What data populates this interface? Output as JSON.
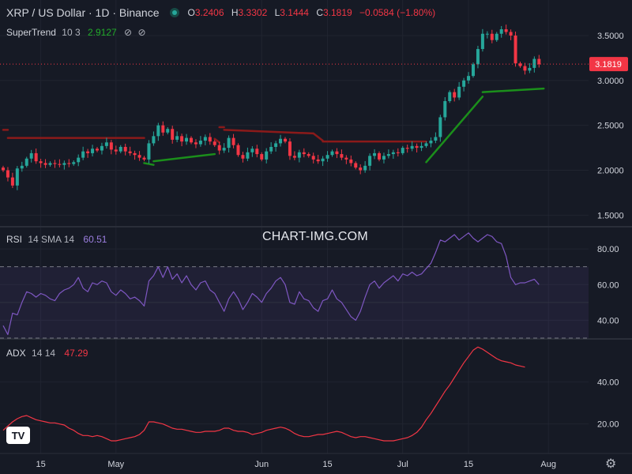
{
  "header": {
    "symbol_title": "XRP / US Dollar · 1D · Binance",
    "ohlc": {
      "o_label": "O",
      "o_value": "3.2406",
      "h_label": "H",
      "h_value": "3.3302",
      "l_label": "L",
      "l_value": "3.1444",
      "c_label": "C",
      "c_value": "3.1819",
      "change": "−0.0584 (−1.80%)"
    }
  },
  "indicators": {
    "supertrend": {
      "name": "SuperTrend",
      "params": "10 3",
      "value": "2.9127"
    },
    "rsi": {
      "name": "RSI",
      "params": "14 SMA 14",
      "value": "60.51"
    },
    "adx": {
      "name": "ADX",
      "params": "14 14",
      "value": "47.29"
    }
  },
  "watermark": "CHART-IMG.COM",
  "logo_text": "TV",
  "icons": [
    "eye-off-icon",
    "settings-gear-icon",
    "live-dot-icon",
    "tradingview-logo"
  ],
  "colors": {
    "background": "#161a25",
    "up": "#26a69a",
    "down": "#f23645",
    "supertrend_up": "#1b8f1b",
    "supertrend_down": "#8b1a1a",
    "rsi_line": "#7e57c2",
    "adx_line": "#f23645"
  },
  "chart_data": [
    {
      "type": "candlestick",
      "title": "XRP / US Dollar · 1D · Binance",
      "y_ticks": [
        "1.5000",
        "2.0000",
        "2.5000",
        "3.0000",
        "3.5000"
      ],
      "ylim": [
        1.38,
        3.72
      ],
      "last_price": "3.1819",
      "x_ticks": [
        {
          "label": "15",
          "index": 8
        },
        {
          "label": "May",
          "index": 24
        },
        {
          "label": "Jun",
          "index": 55
        },
        {
          "label": "15",
          "index": 69
        },
        {
          "label": "Jul",
          "index": 85
        },
        {
          "label": "15",
          "index": 99
        },
        {
          "label": "Aug",
          "index": 116
        }
      ],
      "grid": true,
      "closes": [
        2.0,
        1.92,
        1.83,
        2.02,
        2.05,
        2.13,
        2.19,
        2.1,
        2.08,
        2.06,
        2.08,
        2.07,
        2.06,
        2.08,
        2.07,
        2.09,
        2.14,
        2.21,
        2.19,
        2.24,
        2.22,
        2.27,
        2.31,
        2.23,
        2.21,
        2.26,
        2.21,
        2.19,
        2.17,
        2.14,
        2.12,
        2.3,
        2.38,
        2.5,
        2.42,
        2.46,
        2.34,
        2.38,
        2.32,
        2.36,
        2.31,
        2.29,
        2.33,
        2.37,
        2.32,
        2.28,
        2.22,
        2.25,
        2.36,
        2.28,
        2.17,
        2.13,
        2.2,
        2.24,
        2.18,
        2.12,
        2.21,
        2.26,
        2.3,
        2.35,
        2.32,
        2.16,
        2.14,
        2.2,
        2.18,
        2.16,
        2.12,
        2.1,
        2.13,
        2.17,
        2.21,
        2.18,
        2.14,
        2.12,
        2.08,
        2.03,
        2.0,
        2.05,
        2.16,
        2.19,
        2.12,
        2.16,
        2.18,
        2.2,
        2.19,
        2.25,
        2.24,
        2.27,
        2.25,
        2.27,
        2.3,
        2.33,
        2.37,
        2.59,
        2.77,
        2.87,
        2.81,
        2.93,
        3.0,
        3.05,
        3.18,
        3.35,
        3.52,
        3.52,
        3.45,
        3.52,
        3.57,
        3.54,
        3.5,
        3.19,
        3.16,
        3.11,
        3.14,
        3.24,
        3.18
      ],
      "supertrend": [
        {
          "from": 0,
          "to": 1,
          "trend": "down",
          "values": [
            2.45,
            2.45
          ]
        },
        {
          "from": 1,
          "to": 30,
          "trend": "down",
          "values": [
            2.36,
            2.36
          ]
        },
        {
          "from": 30,
          "to": 32,
          "trend": "up",
          "values": [
            2.08,
            2.06
          ]
        },
        {
          "from": 32,
          "to": 45,
          "trend": "up",
          "values": [
            2.1,
            2.18
          ]
        },
        {
          "from": 45,
          "to": 46,
          "trend": "down",
          "values": [
            2.35,
            2.31
          ]
        },
        {
          "from": 46,
          "to": 47,
          "trend": "down",
          "values": [
            2.48,
            2.48
          ]
        },
        {
          "from": 47,
          "to": 66,
          "trend": "down",
          "values": [
            2.45,
            2.41
          ]
        },
        {
          "from": 66,
          "to": 68,
          "trend": "down",
          "values": [
            2.41,
            2.33
          ]
        },
        {
          "from": 68,
          "to": 90,
          "trend": "down",
          "values": [
            2.32,
            2.32
          ]
        },
        {
          "from": 90,
          "to": 102,
          "trend": "up",
          "values": [
            2.09,
            2.82
          ]
        },
        {
          "from": 102,
          "to": 115,
          "trend": "up",
          "values": [
            2.87,
            2.91
          ]
        }
      ]
    },
    {
      "type": "line",
      "title": "RSI 14 SMA 14",
      "ylabel": "",
      "y_ticks": [
        "40.00",
        "60.00",
        "80.00"
      ],
      "ylim": [
        30,
        92
      ],
      "bands": [
        30,
        70
      ],
      "values": [
        37,
        32,
        44,
        43,
        50,
        56,
        55,
        53,
        55,
        54,
        52,
        51,
        55,
        57,
        58,
        60,
        64,
        58,
        56,
        61,
        60,
        62,
        61,
        56,
        54,
        57,
        55,
        52,
        53,
        51,
        48,
        62,
        65,
        70,
        64,
        70,
        63,
        66,
        61,
        65,
        60,
        57,
        61,
        62,
        57,
        55,
        50,
        45,
        52,
        56,
        52,
        46,
        50,
        55,
        53,
        50,
        55,
        58,
        62,
        64,
        60,
        50,
        49,
        56,
        52,
        51,
        47,
        45,
        51,
        52,
        57,
        52,
        50,
        46,
        42,
        40,
        45,
        53,
        60,
        62,
        58,
        61,
        63,
        65,
        62,
        66,
        65,
        67,
        65,
        66,
        69,
        72,
        78,
        85,
        84,
        86,
        88,
        85,
        87,
        89,
        86,
        84,
        86,
        88,
        87,
        84,
        83,
        76,
        64,
        60,
        61,
        61,
        62,
        63,
        60
      ]
    },
    {
      "type": "line",
      "title": "ADX 14 14",
      "ylabel": "",
      "y_ticks": [
        "20.00",
        "40.00"
      ],
      "ylim": [
        6,
        60
      ],
      "values": [
        17,
        19,
        21,
        22.5,
        23.5,
        24,
        23,
        22,
        21.5,
        21,
        20.5,
        20.5,
        20,
        19.5,
        18,
        17,
        15.5,
        14.5,
        14.5,
        14,
        14.5,
        14,
        13,
        12,
        12,
        12.5,
        13,
        13.5,
        14,
        15,
        17,
        21,
        21,
        20.5,
        20,
        19,
        18,
        17.5,
        17.5,
        17,
        16.5,
        16,
        16,
        16.5,
        16.5,
        16.5,
        17,
        18,
        18,
        17,
        16.5,
        16.5,
        16,
        15,
        15.5,
        16,
        17,
        17.5,
        18,
        18.5,
        18,
        17,
        15.5,
        14.5,
        14,
        14,
        14.5,
        15,
        15,
        15.5,
        16,
        16.5,
        16,
        15,
        14,
        13.5,
        14,
        14,
        13.5,
        13,
        12.5,
        12,
        12,
        12,
        12.5,
        13,
        13.5,
        14.5,
        16,
        18.5,
        22,
        25,
        28.5,
        32,
        35.5,
        38.5,
        42,
        45.5,
        49,
        52,
        55,
        56.5,
        55.5,
        54,
        52.5,
        51,
        50,
        49.5,
        49,
        48,
        47.5,
        47
      ]
    }
  ]
}
